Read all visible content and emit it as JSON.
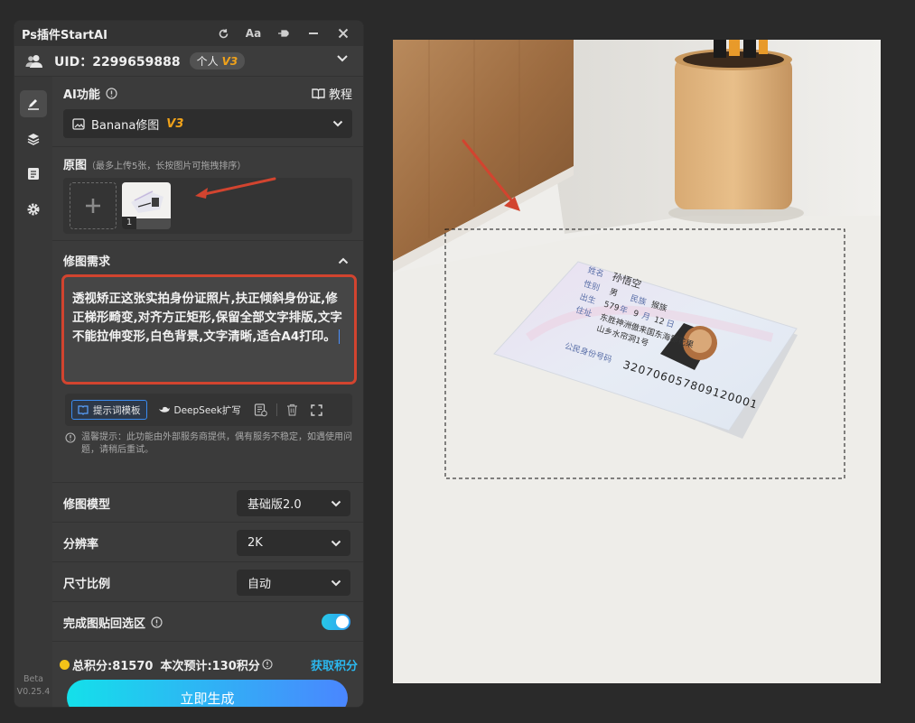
{
  "window": {
    "title": "Ps插件StartAI"
  },
  "user": {
    "uid": "UID：2299659888",
    "plan": "个人",
    "level": "V3"
  },
  "ai_function": {
    "label": "AI功能",
    "tutorial": "教程",
    "selected_model": "Banana修图",
    "model_version": "V3"
  },
  "original": {
    "label": "原图",
    "hint": "（最多上传5张，长按图片可拖拽排序）",
    "image_count_label": "1"
  },
  "edit_request": {
    "label": "修图需求",
    "prompt": "透视矫正这张实拍身份证照片,扶正倾斜身份证,修正梯形畸变,对齐方正矩形,保留全部文字排版,文字不能拉伸变形,白色背景,文字清晰,适合A4打印。",
    "template_button": "提示词模板",
    "deepseek_button": "DeepSeek扩写",
    "notice": "温馨提示：此功能由外部服务商提供，偶有服务不稳定，如遇使用问题，请稍后重试。"
  },
  "settings": {
    "model": {
      "label": "修图模型",
      "value": "基础版2.0"
    },
    "resolution": {
      "label": "分辨率",
      "value": "2K"
    },
    "ratio": {
      "label": "尺寸比例",
      "value": "自动"
    },
    "paste_back": {
      "label": "完成图贴回选区",
      "enabled": true
    }
  },
  "footer": {
    "total_points": "总积分:81570",
    "estimate": "本次预计:130积分",
    "get_points": "获取积分",
    "generate": "立即生成"
  },
  "sidebar": {
    "beta": "Beta",
    "version": "V0.25.4"
  },
  "id_card": {
    "name_label": "姓名",
    "name": "孙悟空",
    "sex_label": "性别",
    "sex": "男",
    "ethnic_label": "民族",
    "ethnic": "猴族",
    "birth_label": "出生",
    "birth_year": "579",
    "birth_month": "9",
    "birth_day": "12",
    "year_unit": "年",
    "month_unit": "月",
    "day_unit": "日",
    "address_label": "住址",
    "address_line1": "东胜神洲傲来国东海郡花果",
    "address_line2": "山乡水帘洞1号",
    "id_label": "公民身份号码",
    "id_number": "320706057809120001"
  },
  "colors": {
    "accent": "#2bb8ef",
    "annotation_red": "#d2442f",
    "badge_gold": "#f0a21a"
  }
}
